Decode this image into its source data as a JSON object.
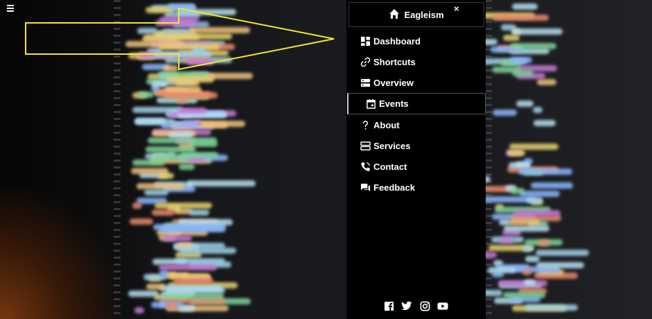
{
  "header": {
    "menu_icon": "hamburger-icon"
  },
  "sidebar": {
    "brand": {
      "icon": "home-icon",
      "label": "Eagleism"
    },
    "close_label": "×",
    "items": [
      {
        "icon": "dashboard-icon",
        "label": "Dashboard"
      },
      {
        "icon": "link-icon",
        "label": "Shortcuts"
      },
      {
        "icon": "server-icon",
        "label": "Overview"
      },
      {
        "icon": "calendar-icon",
        "label": "Events",
        "active": true
      },
      {
        "icon": "question-icon",
        "label": "About"
      },
      {
        "icon": "services-icon",
        "label": "Services"
      },
      {
        "icon": "phone-icon",
        "label": "Contact"
      },
      {
        "icon": "chat-icon",
        "label": "Feedback"
      }
    ],
    "social": [
      "facebook-icon",
      "twitter-icon",
      "instagram-icon",
      "youtube-icon"
    ]
  },
  "annotation": {
    "arrow_color": "#f2e82a"
  },
  "background": {
    "theme": "blurred source code"
  }
}
